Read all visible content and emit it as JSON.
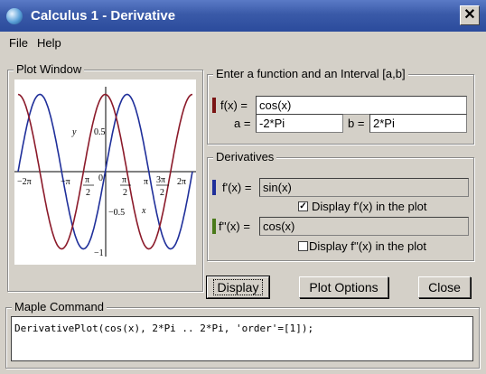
{
  "window": {
    "title": "Calculus 1 - Derivative",
    "close_glyph": "✕"
  },
  "menu": [
    "File",
    "Help"
  ],
  "plot_window": {
    "legend": "Plot Window",
    "x_ticks": [
      "−2π",
      "−π",
      "π",
      "2",
      "0",
      "π",
      "2",
      "π",
      "3π",
      "2",
      "2π"
    ],
    "y_ticks": [
      "0.5",
      "−0.5",
      "−1"
    ],
    "axis_labels": {
      "y": "y",
      "x": "x"
    },
    "series": [
      {
        "color": "#1f2f9a",
        "function": "sin"
      },
      {
        "color": "#8b1a2a",
        "function": "cos"
      }
    ],
    "domain": [
      -6.2832,
      6.2832
    ],
    "range": [
      -1.1,
      1.1
    ]
  },
  "function_group": {
    "legend": "Enter a function and an Interval [a,b]",
    "f_label": "f(x) =",
    "f_value": "cos(x)",
    "a_label": "a =",
    "a_value": "-2*Pi",
    "b_label": "b =",
    "b_value": "2*Pi",
    "accent": "#7a1414"
  },
  "derivatives": {
    "legend": "Derivatives",
    "first_label": "f'(x) =",
    "first_value": "sin(x)",
    "first_color": "#1f2f9a",
    "first_display": "Display f'(x) in the plot",
    "first_checked": true,
    "second_label": "f''(x) =",
    "second_value": "cos(x)",
    "second_color": "#4a7a1a",
    "second_display": "Display f''(x) in the plot",
    "second_checked": false
  },
  "buttons": {
    "display": "Display",
    "plot_options": "Plot Options",
    "close": "Close"
  },
  "maple": {
    "legend": "Maple Command",
    "command": "DerivativePlot(cos(x), 2*Pi .. 2*Pi, 'order'=[1]);"
  }
}
